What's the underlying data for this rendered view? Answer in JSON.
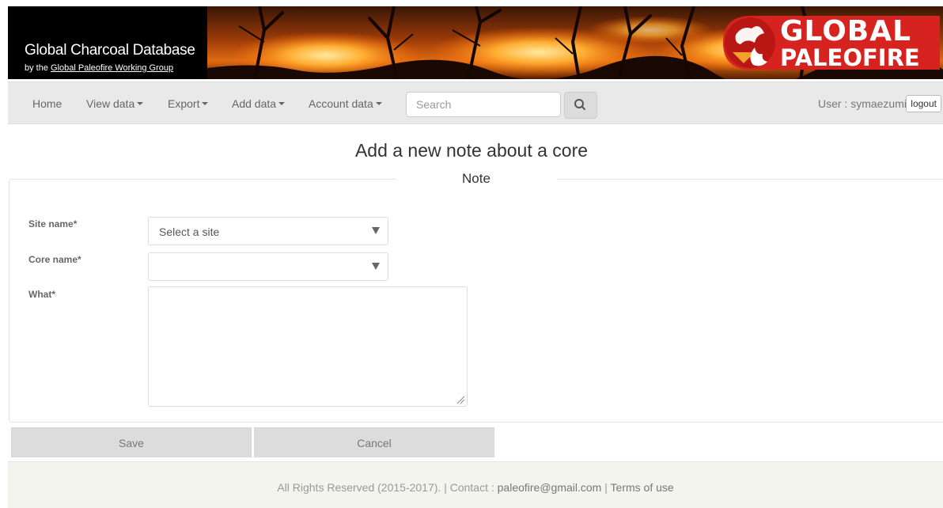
{
  "header": {
    "site_title": "Global Charcoal Database",
    "subtitle_prefix": "by the ",
    "subtitle_link": "Global Paleofire Working Group",
    "logo_line1": "GLOBAL",
    "logo_line2": "PALEOFIRE",
    "logo_color": "#d6231f"
  },
  "nav": {
    "items": [
      {
        "label": "Home",
        "has_caret": false
      },
      {
        "label": "View data",
        "has_caret": true
      },
      {
        "label": "Export",
        "has_caret": true
      },
      {
        "label": "Add data",
        "has_caret": true
      },
      {
        "label": "Account data",
        "has_caret": true
      }
    ],
    "search_placeholder": "Search",
    "search_icon": "search-icon",
    "user_label": "User : symaezumi",
    "logout_label": "logout"
  },
  "page": {
    "title": "Add a new note about a core",
    "legend": "Note"
  },
  "form": {
    "site_label": "Site name*",
    "site_value": "Select a site",
    "core_label": "Core name*",
    "core_value": "",
    "what_label": "What*",
    "what_value": "",
    "save_label": "Save",
    "cancel_label": "Cancel"
  },
  "footer": {
    "rights": "All Rights Reserved (2015-2017). | Contact : ",
    "email": "paleofire@gmail.com",
    "separator": " | ",
    "terms": "Terms of use"
  }
}
